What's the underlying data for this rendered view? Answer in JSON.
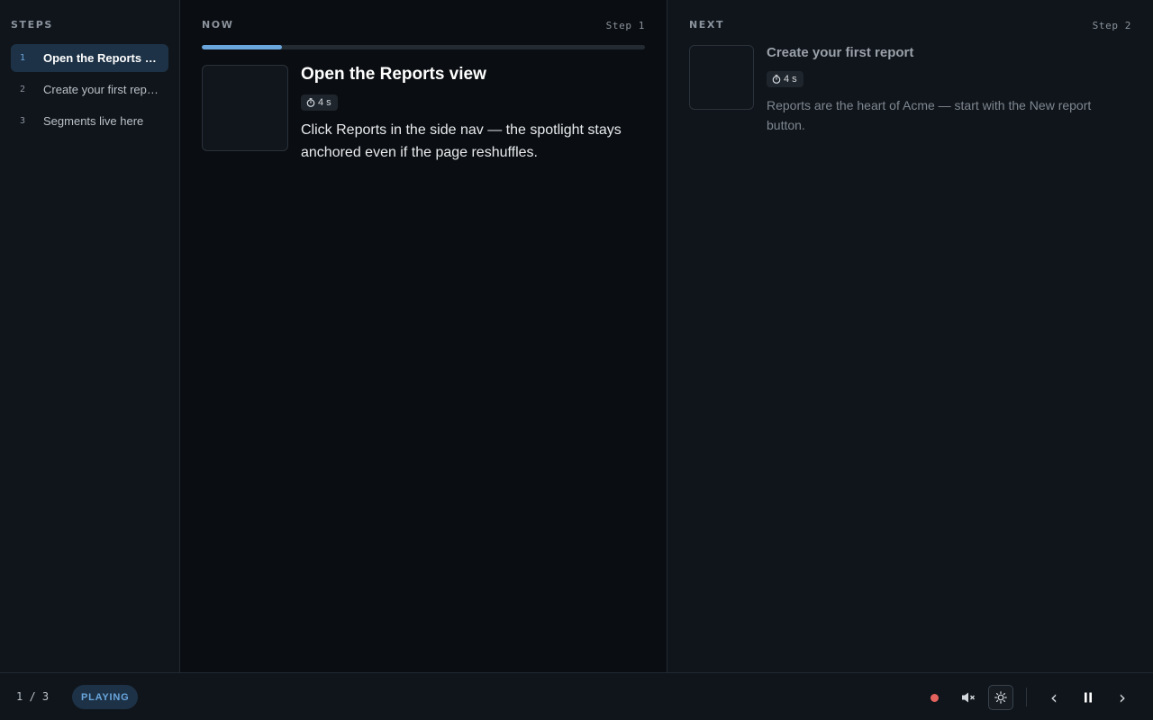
{
  "sidebar": {
    "title": "STEPS",
    "items": [
      {
        "num": "1",
        "label": "Open the Reports view",
        "active": true
      },
      {
        "num": "2",
        "label": "Create your first report",
        "active": false
      },
      {
        "num": "3",
        "label": "Segments live here",
        "active": false
      }
    ]
  },
  "now": {
    "heading": "NOW",
    "step_label": "Step 1",
    "progress": 0.18,
    "title": "Open the Reports view",
    "timer": "4 s",
    "description": "Click Reports in the side nav — the spotlight stays anchored even if the page reshuffles."
  },
  "next": {
    "heading": "NEXT",
    "step_label": "Step 2",
    "title": "Create your first report",
    "timer": "4 s",
    "description": "Reports are the heart of Acme — start with the New report button."
  },
  "footer": {
    "counter": "1 / 3",
    "status": "PLAYING",
    "icons": {
      "record": "record-dot-icon",
      "mute": "speaker-muted-icon",
      "theme": "sun-icon",
      "prev": "chevron-left-icon",
      "pause": "pause-icon",
      "next": "chevron-right-icon"
    }
  },
  "colors": {
    "accent": "#6aa6dc",
    "accent_bg": "#1d3247",
    "record": "#e5635f"
  }
}
